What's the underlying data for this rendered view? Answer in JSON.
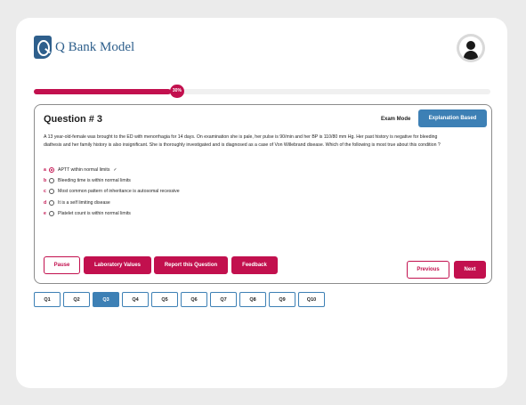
{
  "brand": {
    "name": "Q Bank Model",
    "color": "#2e5f8c",
    "logo_icon": "q-logo-icon"
  },
  "user": {
    "avatar_icon": "user-icon"
  },
  "progress": {
    "percent": 30,
    "label": "30%",
    "color": "#c2104e"
  },
  "question": {
    "title": "Question # 3",
    "mode_label": "Exam Mode",
    "mode_button": "Explanation Based",
    "stem": "A 13 year-old-female was brought to the ED with menorrhagia for 14 days. On examination she is pale, her pulse is 90/min and her BP is 110/80 mm Hg. Her past history is negative for bleeding diathesis and her family history is also insignificant. She is thoroughly investigated and is diagnosed as a case of Von Willebrand disease. Which of the following is most true about this condition ?",
    "options": [
      {
        "letter": "a",
        "text": "APTT within normal limits",
        "selected": true,
        "mark": "✓"
      },
      {
        "letter": "b",
        "text": "Bleeding time is within normal limits",
        "selected": false
      },
      {
        "letter": "c",
        "text": "Most common pattern of inheritance is autosomal recessive",
        "selected": false
      },
      {
        "letter": "d",
        "text": "It is a self limiting disease",
        "selected": false
      },
      {
        "letter": "e",
        "text": "Platelet count is within normal limits",
        "selected": false
      }
    ]
  },
  "actions": {
    "pause": "Pause",
    "lab_values": "Laboratory Values",
    "report": "Report this Question",
    "feedback": "Feedback",
    "previous": "Previous",
    "next": "Next"
  },
  "question_nav": {
    "items": [
      "Q1",
      "Q2",
      "Q3",
      "Q4",
      "Q5",
      "Q6",
      "Q7",
      "Q8",
      "Q9",
      "Q10"
    ],
    "active_index": 2
  },
  "colors": {
    "accent": "#c2104e",
    "primary": "#3d80b5",
    "background": "#ebebeb"
  }
}
